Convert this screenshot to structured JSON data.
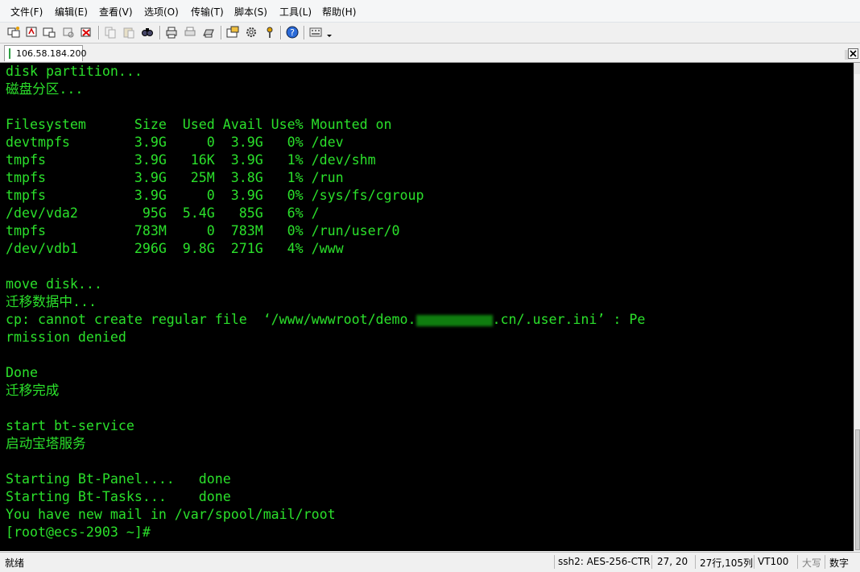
{
  "menu": [
    "文件(F)",
    "编辑(E)",
    "查看(V)",
    "选项(O)",
    "传输(T)",
    "脚本(S)",
    "工具(L)",
    "帮助(H)"
  ],
  "toolbar": {
    "icons": [
      "connect-icon",
      "quick-connect-icon",
      "connect-tab-icon",
      "reconnect-icon",
      "disconnect-icon",
      "copy-icon",
      "paste-icon",
      "find-icon",
      "print-icon",
      "print-selection-icon",
      "printer-setup-icon",
      "session-options-icon",
      "global-options-icon",
      "keymap-icon",
      "help-icon",
      "keyboard-icon"
    ]
  },
  "tab": {
    "label": "106.58.184.200"
  },
  "terminal": {
    "lines": [
      "disk partition...",
      "磁盘分区...",
      "",
      "Filesystem      Size  Used Avail Use% Mounted on",
      "devtmpfs        3.9G     0  3.9G   0% /dev",
      "tmpfs           3.9G   16K  3.9G   1% /dev/shm",
      "tmpfs           3.9G   25M  3.8G   1% /run",
      "tmpfs           3.9G     0  3.9G   0% /sys/fs/cgroup",
      "/dev/vda2        95G  5.4G   85G   6% /",
      "tmpfs           783M     0  783M   0% /run/user/0",
      "/dev/vdb1       296G  9.8G  271G   4% /www",
      "",
      "move disk...",
      "迁移数据中...",
      "",
      "rmission denied",
      "",
      "Done",
      "迁移完成",
      "",
      "start bt-service",
      "启动宝塔服务",
      "",
      "Starting Bt-Panel....   done",
      "Starting Bt-Tasks...    done",
      "You have new mail in /var/spool/mail/root",
      "[root@ecs-2903 ~]#"
    ],
    "cp_error_prefix": "cp: cannot create regular file  ‘/www/wwwroot/demo.",
    "cp_error_suffix": ".cn/.user.ini’ : Pe"
  },
  "status": {
    "ready": "就绪",
    "cipher": "ssh2: AES-256-CTR",
    "cursor": "27, 20",
    "size": "27行,105列",
    "term": "VT100",
    "caps": "大写",
    "num": "数字"
  },
  "colors": {
    "terminal_bg": "#000000",
    "terminal_fg": "#2be02b"
  }
}
